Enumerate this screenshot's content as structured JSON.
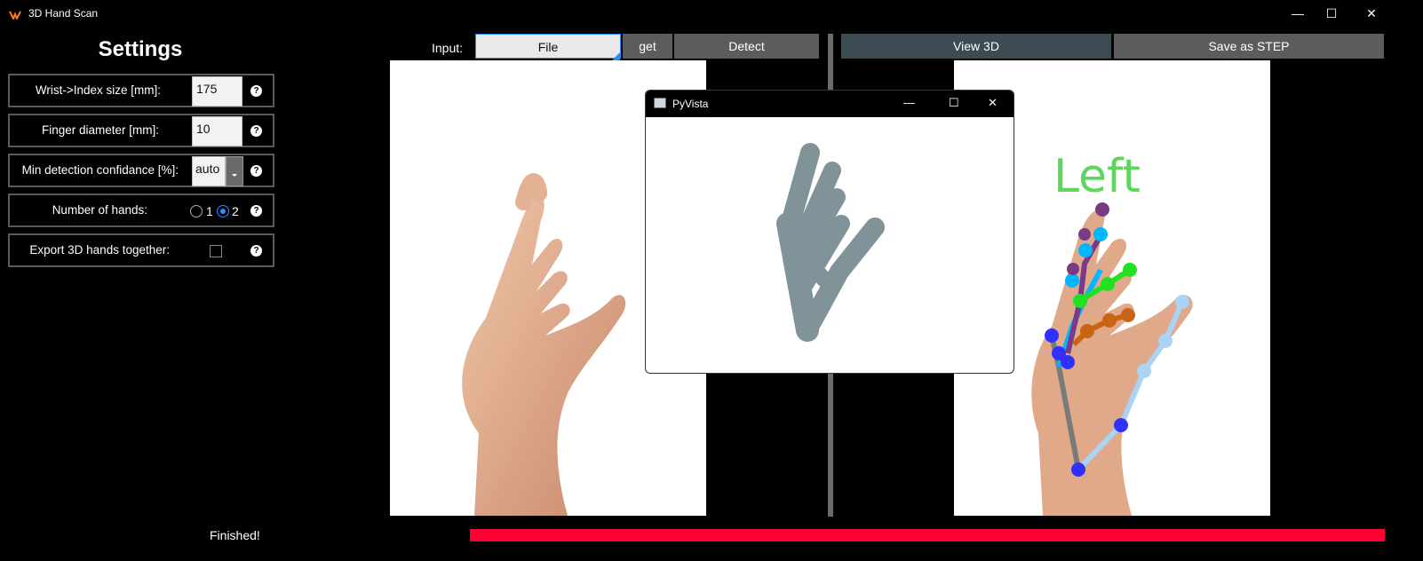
{
  "window": {
    "title": "3D Hand Scan",
    "controls": {
      "minimize": "—",
      "maximize": "☐",
      "close": "✕"
    }
  },
  "settings": {
    "title": "Settings",
    "wrist_label": "Wrist->Index size [mm]:",
    "wrist_value": "175",
    "finger_label": "Finger diameter [mm]:",
    "finger_value": "10",
    "confidence_label": "Min detection confidance [%]:",
    "confidence_value": "auto",
    "hands_label": "Number of hands:",
    "hands_options": [
      "1",
      "2"
    ],
    "hands_selected": "2",
    "export_label": "Export 3D hands together:",
    "export_checked": false,
    "help": "?"
  },
  "toolbar": {
    "input_label": "Input:",
    "file_label": "File",
    "get_label": "get",
    "detect_label": "Detect",
    "view3d_label": "View 3D",
    "save_label": "Save as STEP"
  },
  "overlay_text": "Left",
  "pyvista": {
    "title": "PyVista",
    "controls": {
      "minimize": "—",
      "maximize": "☐",
      "close": "✕"
    }
  },
  "status": {
    "text": "Finished!",
    "progress": 1.0,
    "progress_color": "#ff0033"
  },
  "colors": {
    "accent": "#1e90ff",
    "button": "#5c5c5c",
    "view3d": "#3c4c52",
    "file_button": "#e9e9e9"
  }
}
